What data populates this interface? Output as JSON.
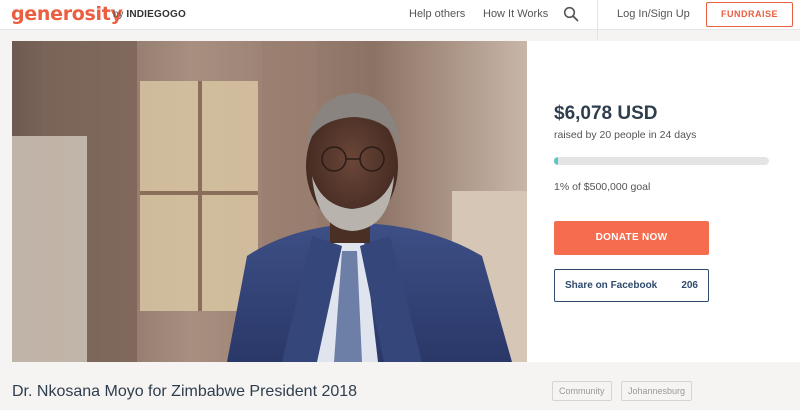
{
  "header": {
    "logo": "generosity",
    "by": "by",
    "brand": "INDIEGOGO",
    "nav": [
      "Help others",
      "How It Works"
    ],
    "login": "Log In/Sign Up",
    "fundraise": "FUNDRAISE"
  },
  "campaign": {
    "amount": "$6,078 USD",
    "raised_text": "raised by 20 people in 24 days",
    "progress_percent": 1,
    "goal_text": "1% of $500,000 goal",
    "donate_label": "DONATE NOW",
    "share_label": "Share on Facebook",
    "share_count": "206",
    "title": "Dr. Nkosana Moyo for Zimbabwe President 2018",
    "tags": [
      "Community",
      "Johannesburg"
    ]
  },
  "colors": {
    "brand": "#eb5e40",
    "donate": "#f56c4e",
    "progress": "#5bc6c3",
    "share": "#2e4a6c"
  }
}
